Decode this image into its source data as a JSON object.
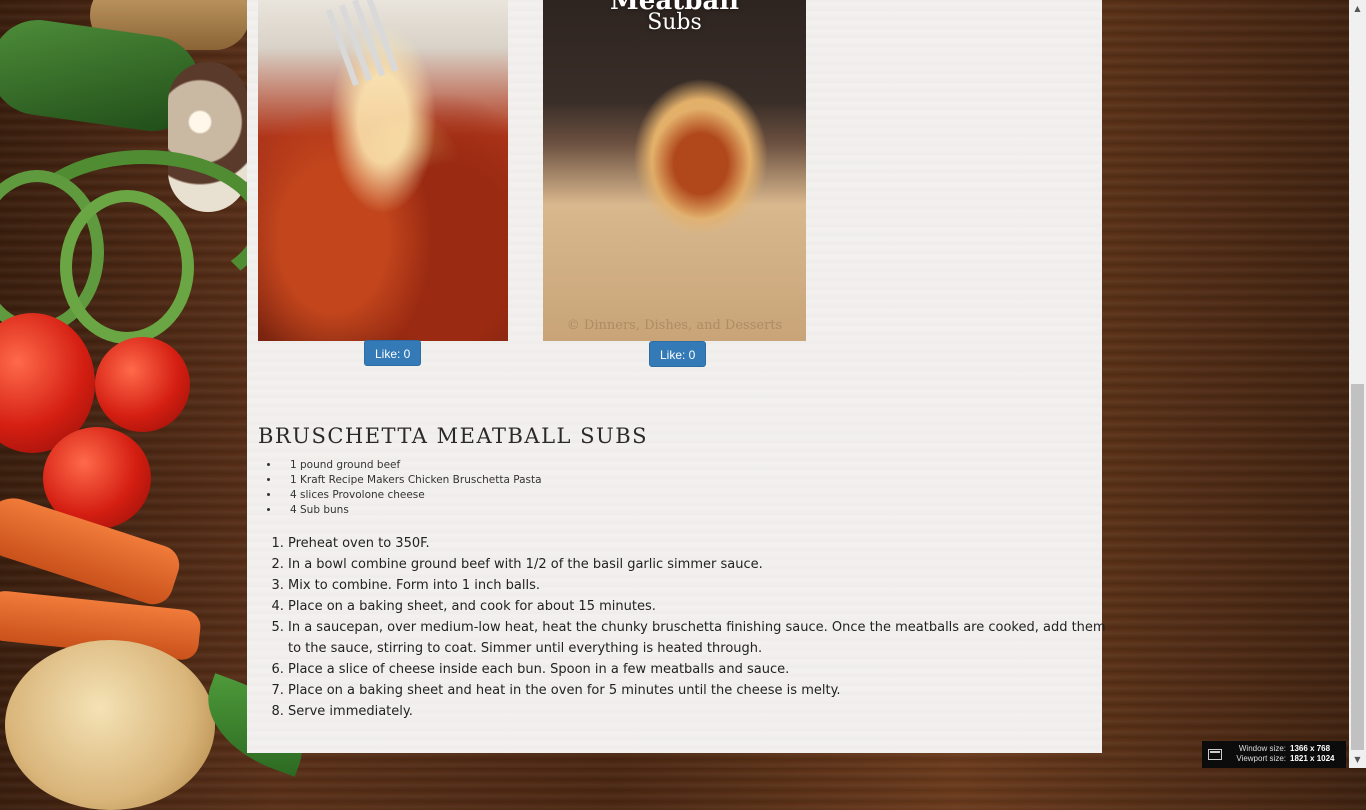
{
  "gallery": {
    "items": [
      {
        "like_label": "Like: 0"
      },
      {
        "like_label": "Like: 0",
        "image_title_top": "Meatball",
        "image_title_bottom": "Subs",
        "watermark": "© Dinners, Dishes, and Desserts"
      }
    ]
  },
  "recipe": {
    "title": "Bruschetta Meatball Subs",
    "ingredients": [
      "1 pound ground beef",
      "1 Kraft Recipe Makers Chicken Bruschetta Pasta",
      "4 slices Provolone cheese",
      "4 Sub buns"
    ],
    "steps": [
      "Preheat oven to 350F.",
      "In a bowl combine ground beef with 1/2 of the basil garlic simmer sauce.",
      "Mix to combine. Form into 1 inch balls.",
      "Place on a baking sheet, and cook for about 15 minutes.",
      "In a saucepan, over medium-low heat, heat the chunky bruschetta finishing sauce. Once the meatballs are cooked, add them to the sauce, stirring to coat. Simmer until everything is heated through.",
      "Place a slice of cheese inside each bun. Spoon in a few meatballs and sauce.",
      "Place on a baking sheet and heat in the oven for 5 minutes until the cheese is melty.",
      "Serve immediately."
    ]
  },
  "size_widget": {
    "window_label": "Window size:",
    "window_value": "1366 x 768",
    "viewport_label": "Viewport size:",
    "viewport_value": "1821 x 1024"
  },
  "colors": {
    "like_button": "#337ab7",
    "content_bg": "#f3f1ef",
    "wood_bg": "#4a2712"
  }
}
